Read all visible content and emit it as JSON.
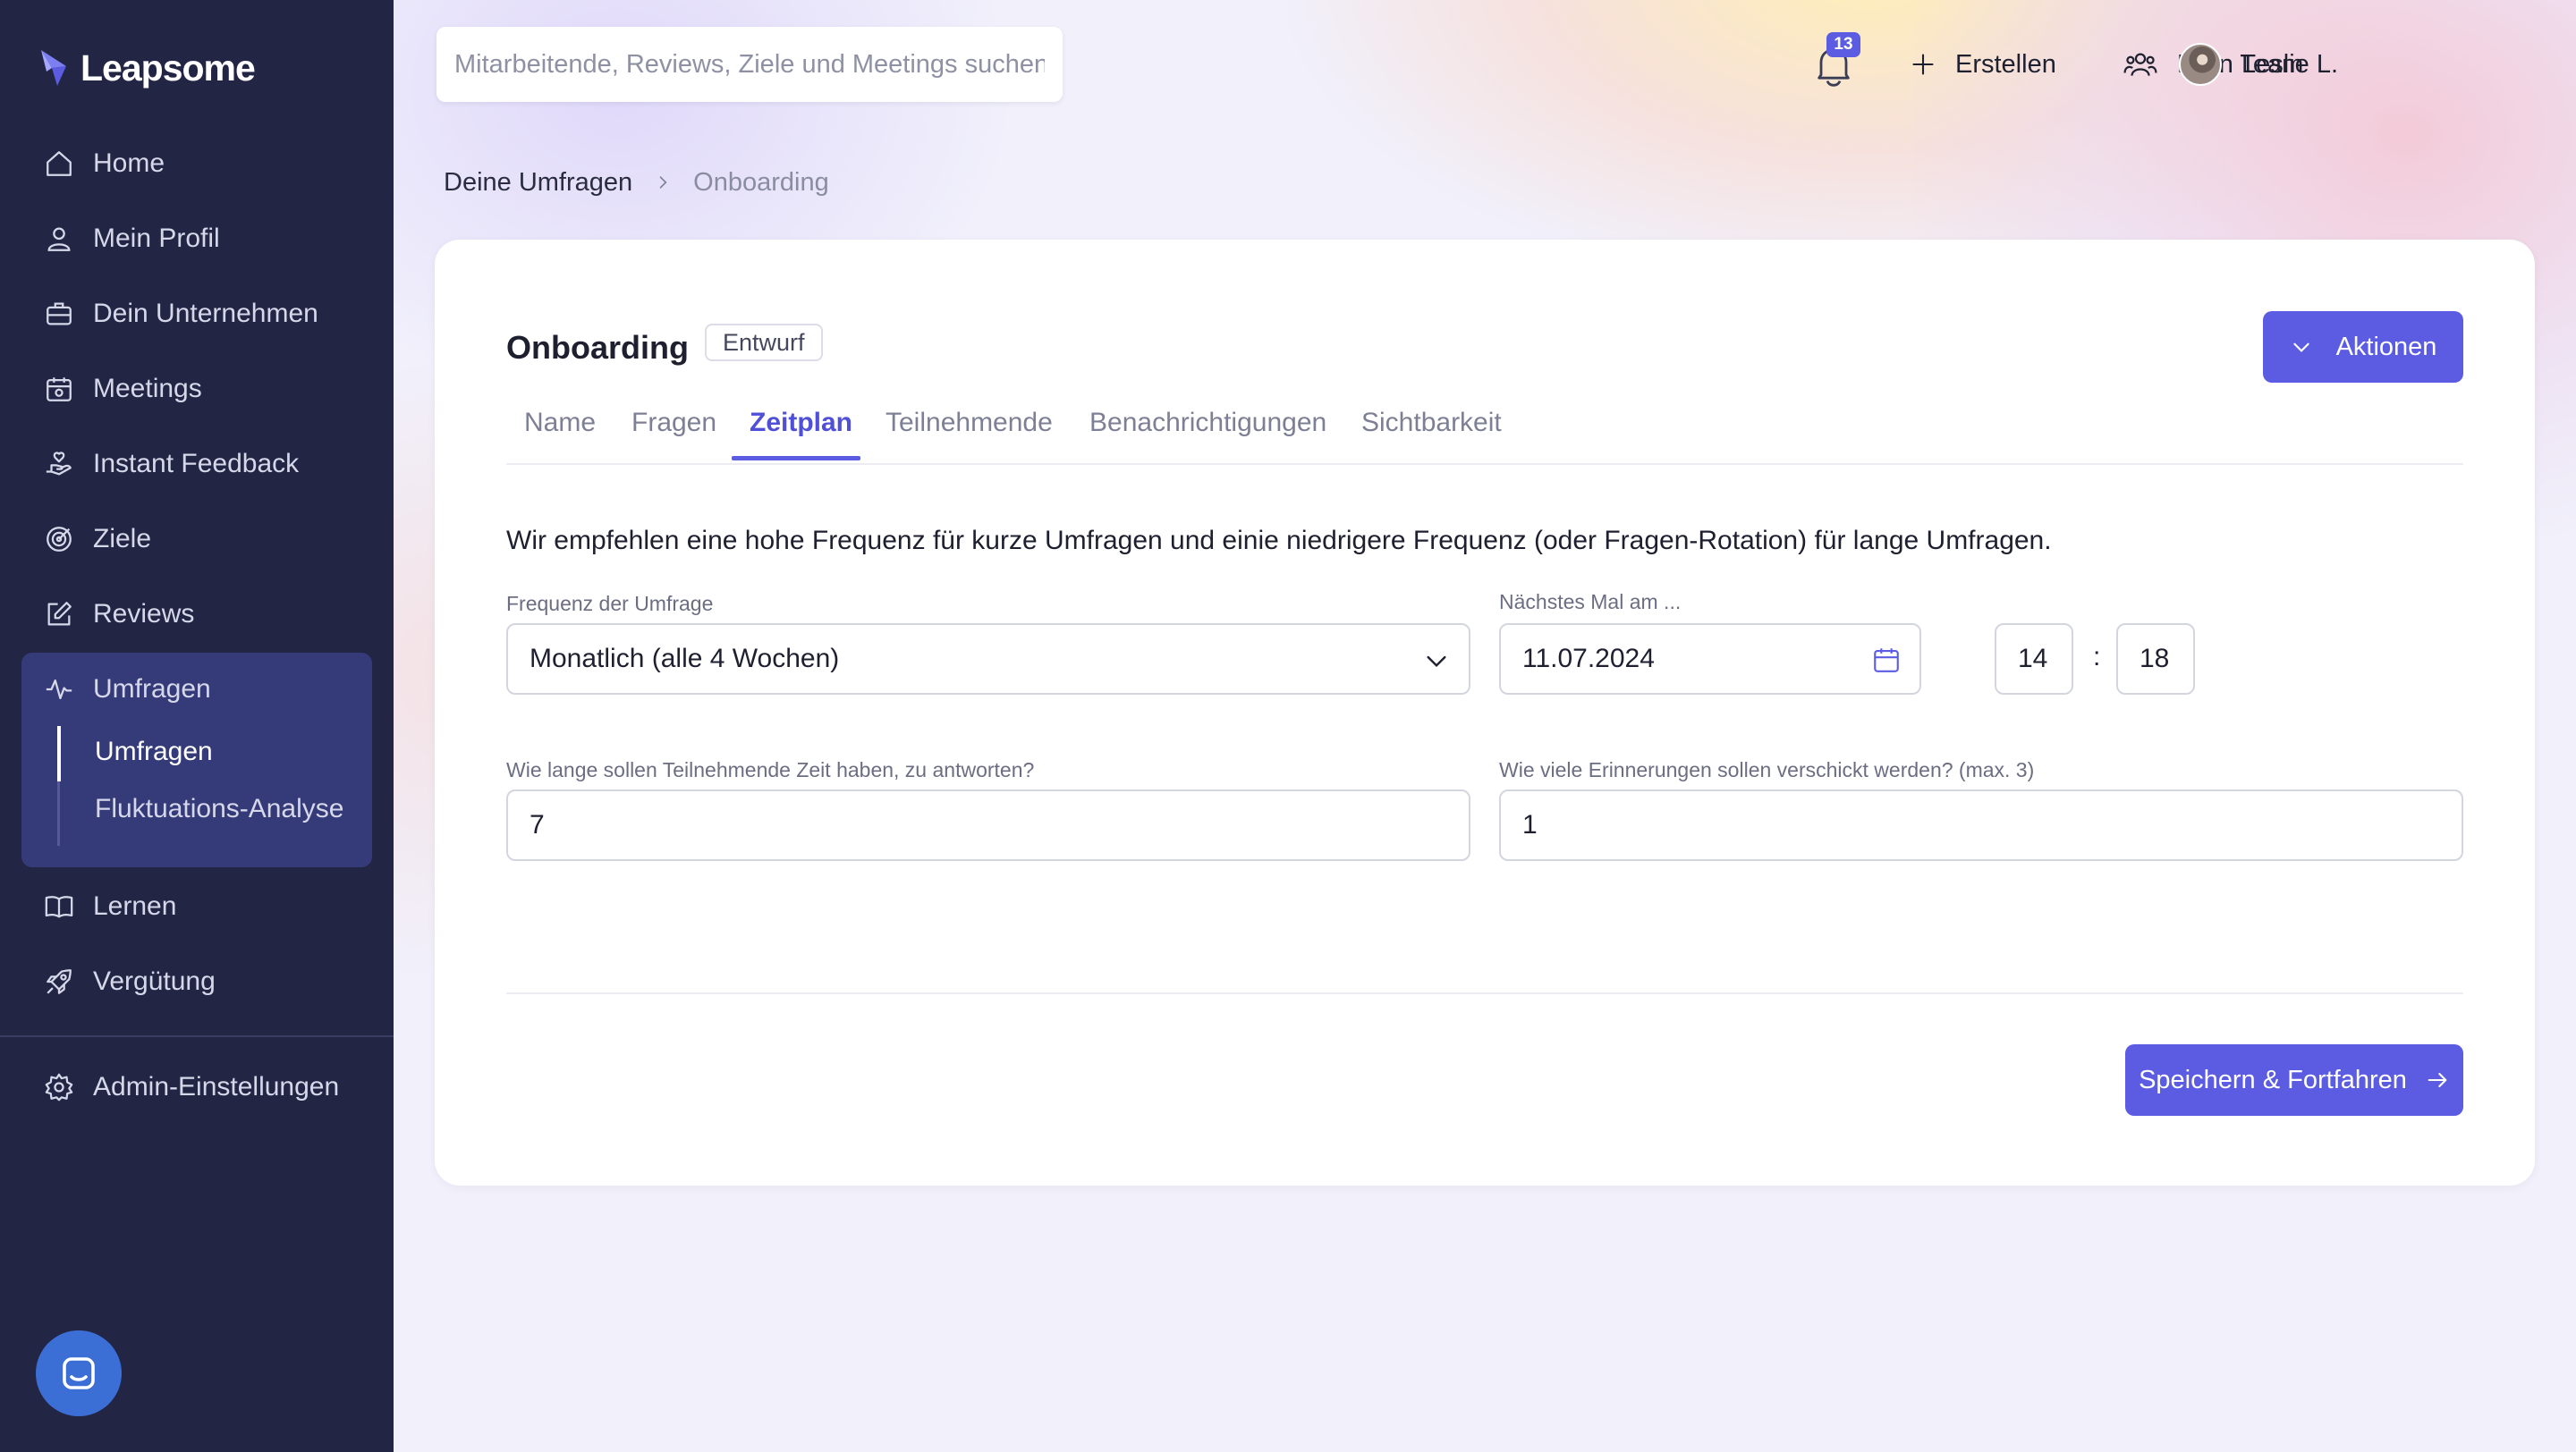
{
  "brand": {
    "name": "Leapsome",
    "logo_icon": "leapsome-logo-icon",
    "accent": "#5b5ce2",
    "sidebar_bg": "#232545"
  },
  "sidebar": {
    "items": [
      {
        "label": "Home",
        "icon": "home-icon"
      },
      {
        "label": "Mein Profil",
        "icon": "user-icon"
      },
      {
        "label": "Dein Unternehmen",
        "icon": "briefcase-icon"
      },
      {
        "label": "Meetings",
        "icon": "calendar-meetings-icon"
      },
      {
        "label": "Instant Feedback",
        "icon": "feedback-hand-icon"
      },
      {
        "label": "Ziele",
        "icon": "target-icon"
      },
      {
        "label": "Reviews",
        "icon": "edit-icon"
      },
      {
        "label": "Umfragen",
        "icon": "pulse-icon",
        "active": true
      },
      {
        "label": "Lernen",
        "icon": "book-icon"
      },
      {
        "label": "Vergütung",
        "icon": "rocket-icon"
      },
      {
        "label": "Admin-Einstellungen",
        "icon": "gear-icon"
      }
    ],
    "sub_items": [
      {
        "label": "Umfragen",
        "active": true
      },
      {
        "label": "Fluktuations-Analyse"
      }
    ],
    "chat_icon": "chat-icon"
  },
  "topbar": {
    "search_placeholder": "Mitarbeitende, Reviews, Ziele und Meetings suchen",
    "notification_count": "13",
    "create_label": "Erstellen",
    "team_label": "Mein Team",
    "user_name": "Leslie L."
  },
  "breadcrumb": {
    "parent": "Deine Umfragen",
    "current": "Onboarding"
  },
  "survey": {
    "title": "Onboarding",
    "status": "Entwurf",
    "actions_label": "Aktionen",
    "tabs": [
      {
        "label": "Name"
      },
      {
        "label": "Fragen"
      },
      {
        "label": "Zeitplan",
        "active": true
      },
      {
        "label": "Teilnehmende"
      },
      {
        "label": "Benachrichtigungen"
      },
      {
        "label": "Sichtbarkeit"
      }
    ],
    "info_text": "Wir empfehlen eine hohe Frequenz für kurze Umfragen und einie niedrigere Frequenz (oder Fragen-Rotation) für lange Umfragen.",
    "frequency": {
      "label": "Frequenz der Umfrage",
      "value": "Monatlich (alle 4 Wochen)"
    },
    "next_date": {
      "label": "Nächstes Mal am ...",
      "date": "11.07.2024",
      "hour": "14",
      "minute": "18",
      "separator": ":"
    },
    "response_time": {
      "label": "Wie lange sollen Teilnehmende Zeit haben, zu antworten?",
      "value": "7"
    },
    "reminders": {
      "label": "Wie viele Erinnerungen sollen verschickt werden? (max. 3)",
      "value": "1"
    },
    "save_label": "Speichern & Fortfahren"
  }
}
